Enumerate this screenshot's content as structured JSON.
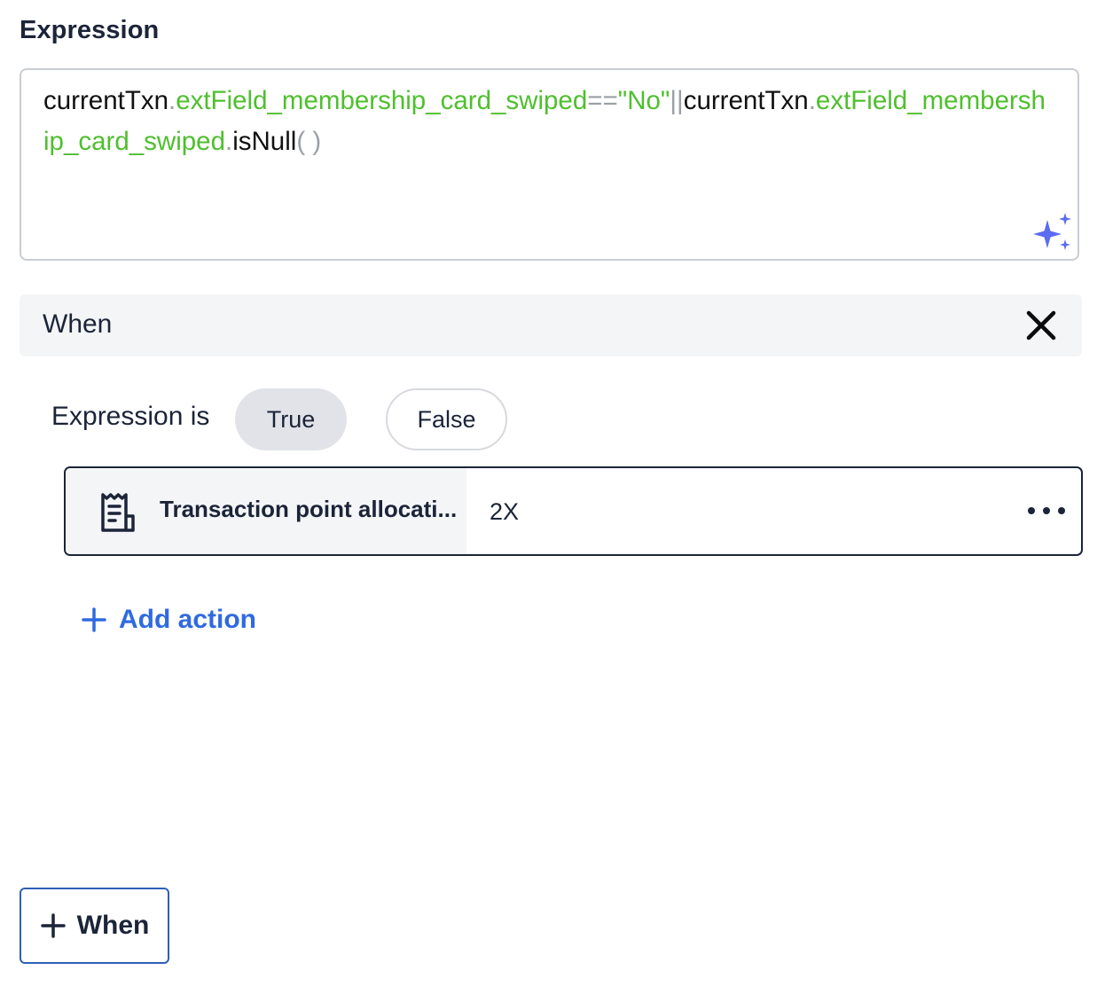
{
  "expression": {
    "title": "Expression",
    "tokens": [
      {
        "text": "currentTxn",
        "style": "black"
      },
      {
        "text": ".",
        "style": "gray"
      },
      {
        "text": "extField_membership_card_swiped",
        "style": "green"
      },
      {
        "text": "==",
        "style": "gray"
      },
      {
        "text": "\"No\"",
        "style": "green"
      },
      {
        "text": "||",
        "style": "gray"
      },
      {
        "text": "currentTxn",
        "style": "black"
      },
      {
        "text": ".",
        "style": "gray"
      },
      {
        "text": "extField_membership_card_swiped",
        "style": "green"
      },
      {
        "text": ".",
        "style": "gray"
      },
      {
        "text": "isNull",
        "style": "black"
      },
      {
        "text": "( )",
        "style": "gray"
      }
    ],
    "assist_icon": "sparkle-icon"
  },
  "when_section": {
    "label": "When",
    "close_icon": "close-icon"
  },
  "condition": {
    "label": "Expression is",
    "options": [
      "True",
      "False"
    ],
    "selected": "True"
  },
  "action": {
    "icon": "receipt-icon",
    "name": "Transaction point allocati...",
    "value": "2X",
    "menu_icon": "more-horizontal-icon"
  },
  "add_action": {
    "label": "Add action",
    "icon": "plus-icon"
  },
  "add_when": {
    "label": "When",
    "icon": "plus-icon"
  },
  "colors": {
    "accent_blue": "#2f6ae0",
    "token_green": "#4fbf2e",
    "token_gray": "#9aa0a6",
    "sparkle": "#5b6cf0"
  }
}
